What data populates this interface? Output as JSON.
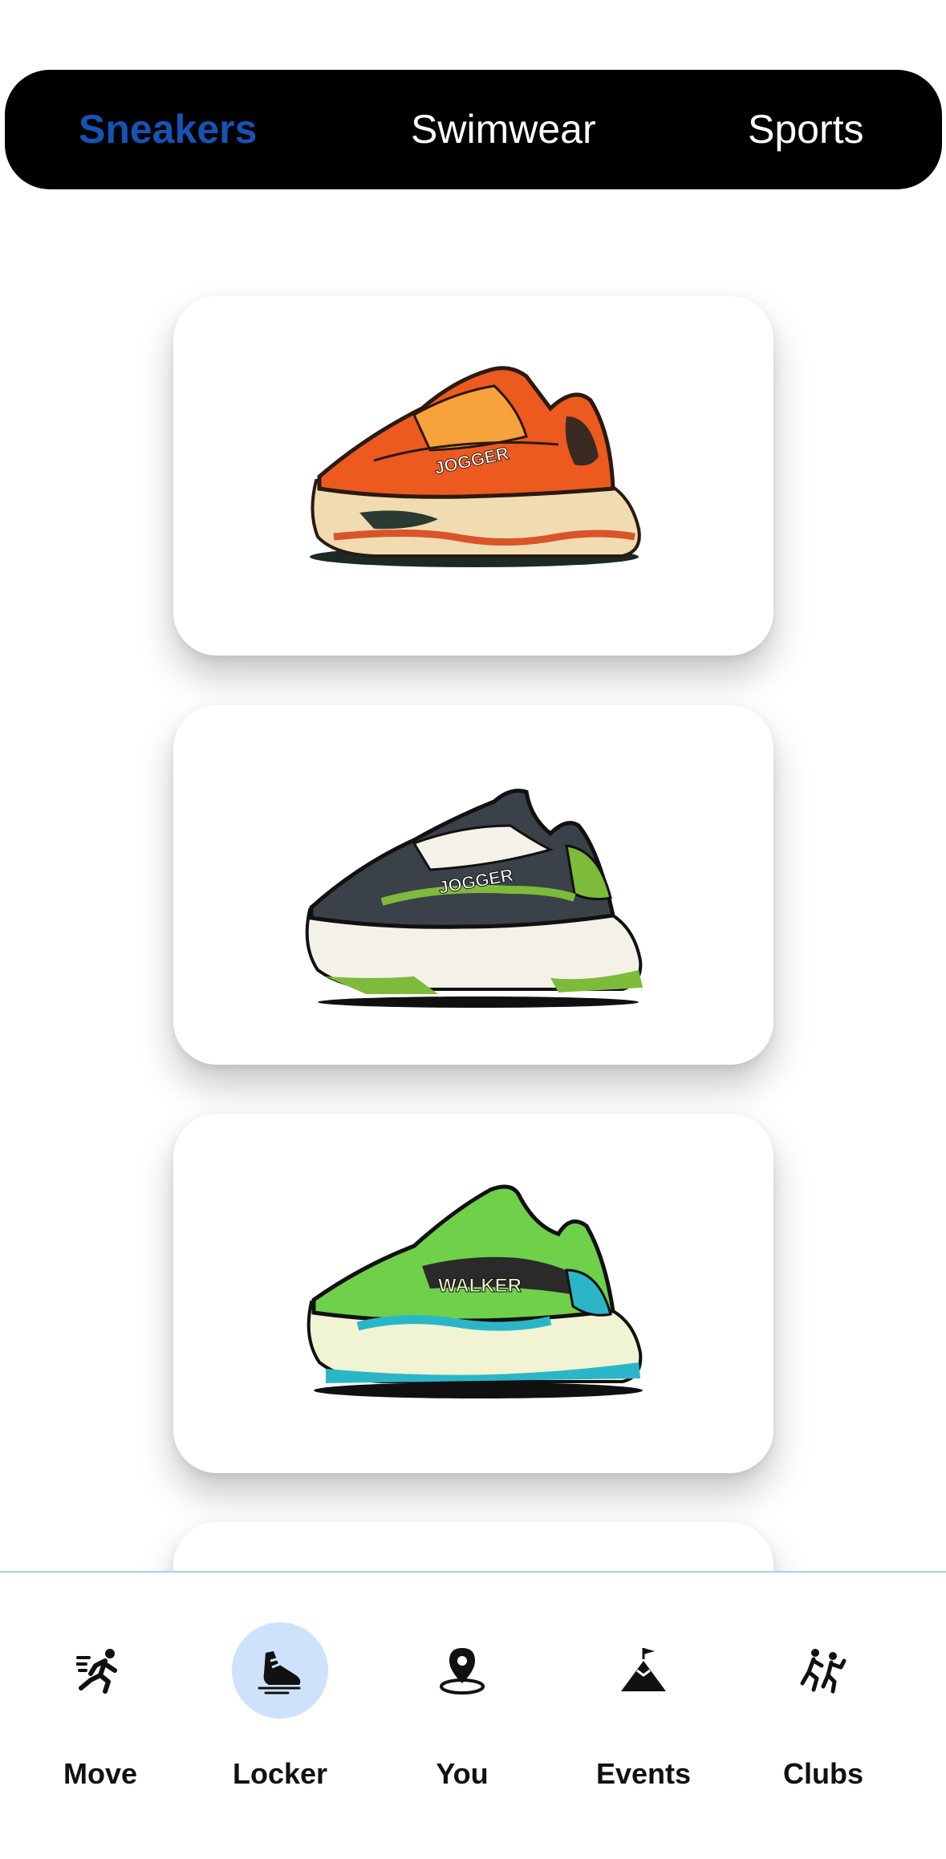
{
  "top_tabs": [
    {
      "label": "Sneakers",
      "active": true
    },
    {
      "label": "Swimwear",
      "active": false
    },
    {
      "label": "Sports",
      "active": false
    }
  ],
  "colors": {
    "active_tab": "#1553b6",
    "tab_bar_bg": "#000000",
    "nav_selected_bg": "#cfe2fb",
    "nav_divider": "#a9cdef"
  },
  "products": [
    {
      "brand_text": "JOGGER",
      "icon": "orange-jogger-sneaker"
    },
    {
      "brand_text": "JOGGER",
      "icon": "grey-green-jogger-sneaker"
    },
    {
      "brand_text": "WALKER",
      "icon": "green-walker-sneaker"
    }
  ],
  "bottom_nav": [
    {
      "label": "Move",
      "icon": "running-icon",
      "selected": false
    },
    {
      "label": "Locker",
      "icon": "sneaker-icon",
      "selected": true
    },
    {
      "label": "You",
      "icon": "location-pin-icon",
      "selected": false
    },
    {
      "label": "Events",
      "icon": "mountain-flag-icon",
      "selected": false
    },
    {
      "label": "Clubs",
      "icon": "group-running-icon",
      "selected": false
    }
  ]
}
